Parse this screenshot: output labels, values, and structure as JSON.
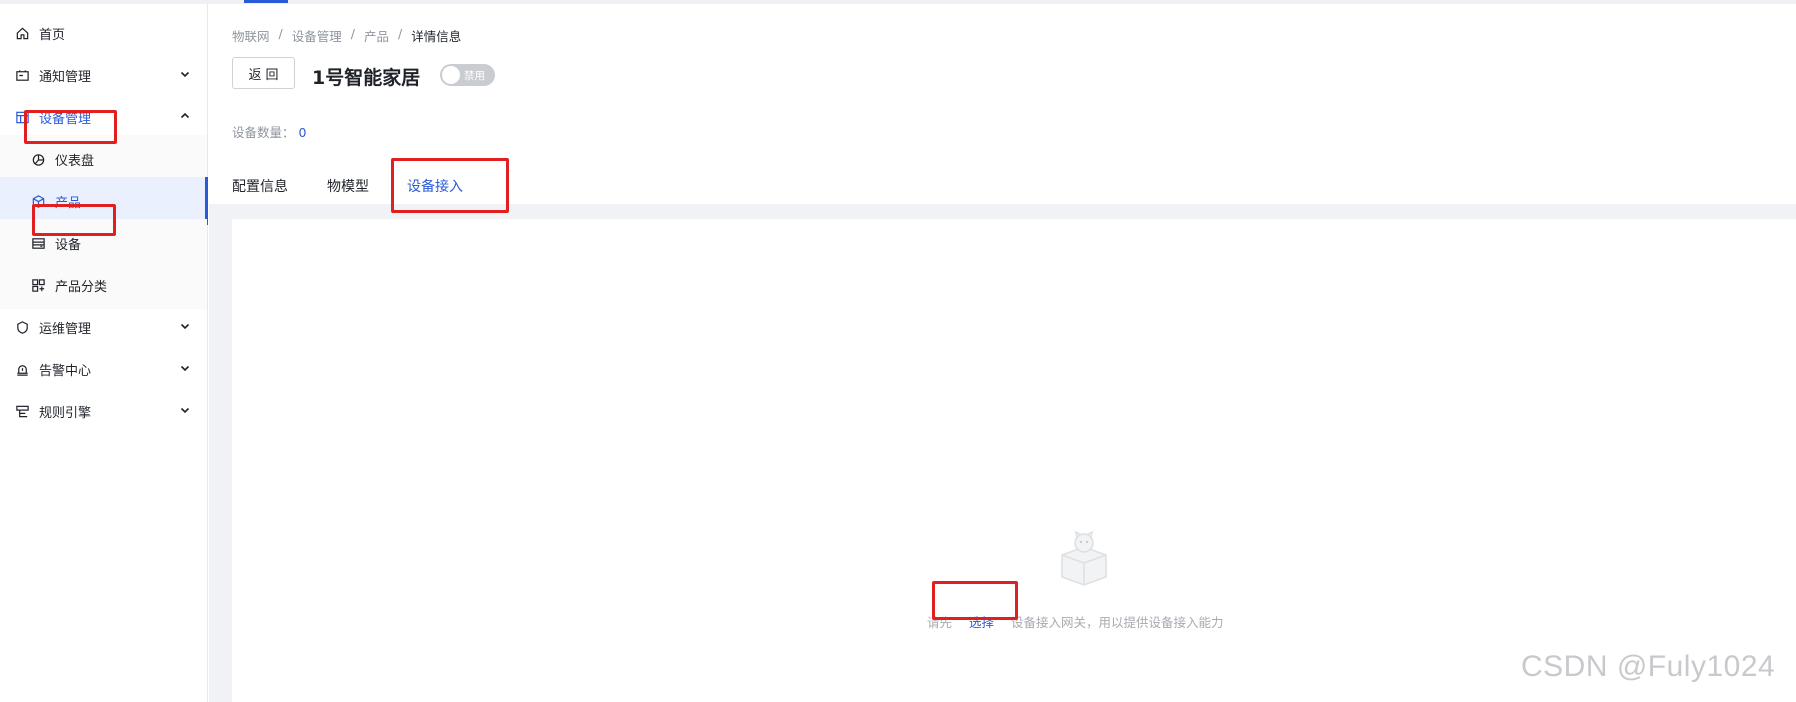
{
  "sidebar": {
    "items": [
      {
        "label": "首页",
        "icon": "home-icon"
      },
      {
        "label": "通知管理",
        "icon": "notice-icon"
      },
      {
        "label": "设备管理",
        "icon": "device-manage-icon"
      },
      {
        "label": "仪表盘",
        "icon": "dashboard-icon"
      },
      {
        "label": "产品",
        "icon": "product-icon"
      },
      {
        "label": "设备",
        "icon": "device-icon"
      },
      {
        "label": "产品分类",
        "icon": "category-icon"
      },
      {
        "label": "运维管理",
        "icon": "ops-icon"
      },
      {
        "label": "告警中心",
        "icon": "alarm-icon"
      },
      {
        "label": "规则引擎",
        "icon": "rule-icon"
      }
    ]
  },
  "breadcrumb": [
    "物联网",
    "设备管理",
    "产品",
    "详情信息"
  ],
  "header": {
    "back_label": "返回",
    "title": "1号智能家居",
    "toggle_label": "禁用"
  },
  "device_count": {
    "label": "设备数量：",
    "value": "0"
  },
  "tabs": [
    {
      "label": "配置信息"
    },
    {
      "label": "物模型"
    },
    {
      "label": "设备接入"
    }
  ],
  "empty": {
    "prefix": "请先",
    "link": "选择",
    "suffix": "设备接入网关，用以提供设备接入能力"
  },
  "watermark": "CSDN @Fuly1024",
  "colors": {
    "accent": "#2a5bd7",
    "highlight": "#e02020"
  }
}
